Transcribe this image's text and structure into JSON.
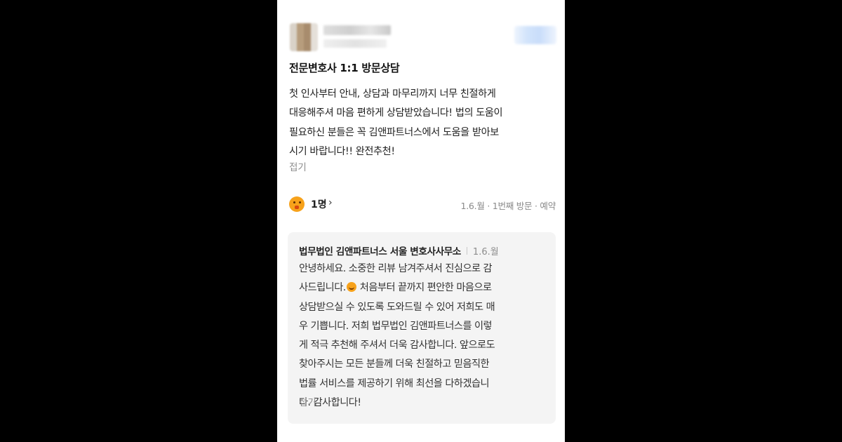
{
  "review": {
    "title": "전문변호사 1:1 방문상담",
    "body_lines": [
      "첫 인사부터 안내, 상담과 마무리까지 너무 친절하게",
      "대응해주셔 마음 편하게 상담받았습니다! 법의 도움이",
      "필요하신 분들은 꼭 김앤파트너스에서 도움을 받아보",
      "시기 바랍니다!! 완전추천!"
    ],
    "fold_label": "접기",
    "reaction_icon": "surprised-face-icon",
    "reaction_count": "1명",
    "reaction_chevron": "›",
    "visit_meta": "1.6.월 · 1번째 방문 · 예약"
  },
  "reply": {
    "author": "법무법인 김앤파트너스 서울 변호사사무소",
    "date": "1.6.월",
    "lines": [
      "안녕하세요. 소중한 리뷰 남겨주셔서 진심으로 감",
      "사드립니다.",
      " 처음부터 끝까지 편안한 마음으로",
      "상담받으실 수 있도록 도와드릴 수 있어 저희도 매",
      "우 기쁩니다. 저희 법무법인 김앤파트너스를 이렇",
      "게 적극 추천해 주셔서 더욱 감사합니다. 앞으로도",
      "찾아주시는 모든 분들께 더욱 친절하고 믿음직한",
      "법률 서비스를 제공하기 위해 최선을 다하겠습니",
      "다. 감사합니다!"
    ],
    "smile_icon": "smiling-face-icon",
    "fold_label": "접기"
  },
  "colors": {
    "background": "#000000",
    "card": "#ffffff",
    "reply_bg": "#f4f4f4",
    "muted": "#8d8d8d",
    "reaction": "#f7a21b"
  }
}
